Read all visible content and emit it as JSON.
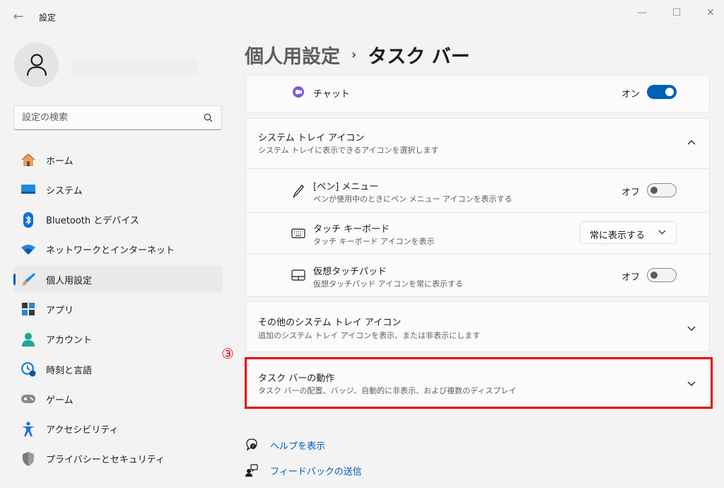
{
  "window": {
    "title": "設定",
    "back_icon": "arrow-left-icon",
    "controls": {
      "minimize": "—",
      "maximize": "☐",
      "close": "✕"
    }
  },
  "profile": {
    "avatar_icon": "person-icon"
  },
  "search": {
    "placeholder": "設定の検索",
    "icon": "search-icon"
  },
  "sidebar": {
    "items": [
      {
        "label": "ホーム",
        "icon": "home-icon",
        "active": false
      },
      {
        "label": "システム",
        "icon": "monitor-icon",
        "active": false
      },
      {
        "label": "Bluetooth とデバイス",
        "icon": "bluetooth-icon",
        "active": false
      },
      {
        "label": "ネットワークとインターネット",
        "icon": "wifi-icon",
        "active": false
      },
      {
        "label": "個人用設定",
        "icon": "brush-icon",
        "active": true
      },
      {
        "label": "アプリ",
        "icon": "apps-icon",
        "active": false
      },
      {
        "label": "アカウント",
        "icon": "account-icon",
        "active": false
      },
      {
        "label": "時刻と言語",
        "icon": "clock-globe-icon",
        "active": false
      },
      {
        "label": "ゲーム",
        "icon": "gamepad-icon",
        "active": false
      },
      {
        "label": "アクセシビリティ",
        "icon": "accessibility-icon",
        "active": false
      },
      {
        "label": "プライバシーとセキュリティ",
        "icon": "shield-icon",
        "active": false
      }
    ]
  },
  "breadcrumb": {
    "parent": "個人用設定",
    "separator": "›",
    "current": "タスク バー"
  },
  "chat_row": {
    "label": "チャット",
    "state_label": "オン",
    "toggle_on": true
  },
  "system_tray": {
    "title": "システム トレイ アイコン",
    "subtitle": "システム トレイに表示できるアイコンを選択します",
    "expanded": true,
    "items": [
      {
        "title": "[ペン] メニュー",
        "subtitle": "ペンが使用中のときにペン メニュー アイコンを表示する",
        "state_label": "オフ",
        "toggle_on": false
      },
      {
        "title": "タッチ キーボード",
        "subtitle": "タッチ キーボード アイコンを表示",
        "dropdown_value": "常に表示する"
      },
      {
        "title": "仮想タッチパッド",
        "subtitle": "仮想タッチパッド アイコンを常に表示する",
        "state_label": "オフ",
        "toggle_on": false
      }
    ]
  },
  "other_tray": {
    "title": "その他のシステム トレイ アイコン",
    "subtitle": "追加のシステム トレイ アイコンを表示、または非表示にします"
  },
  "taskbar_behaviors": {
    "title": "タスク バーの動作",
    "subtitle": "タスク バーの配置、バッジ、自動的に非表示、および複数のディスプレイ"
  },
  "annotation": {
    "marker": "③",
    "color": "#e60012"
  },
  "help": {
    "get_help": "ヘルプを表示",
    "feedback": "フィードバックの送信"
  },
  "colors": {
    "accent": "#005fb8",
    "background": "#f3f3f3",
    "card": "#fbfbfb"
  }
}
